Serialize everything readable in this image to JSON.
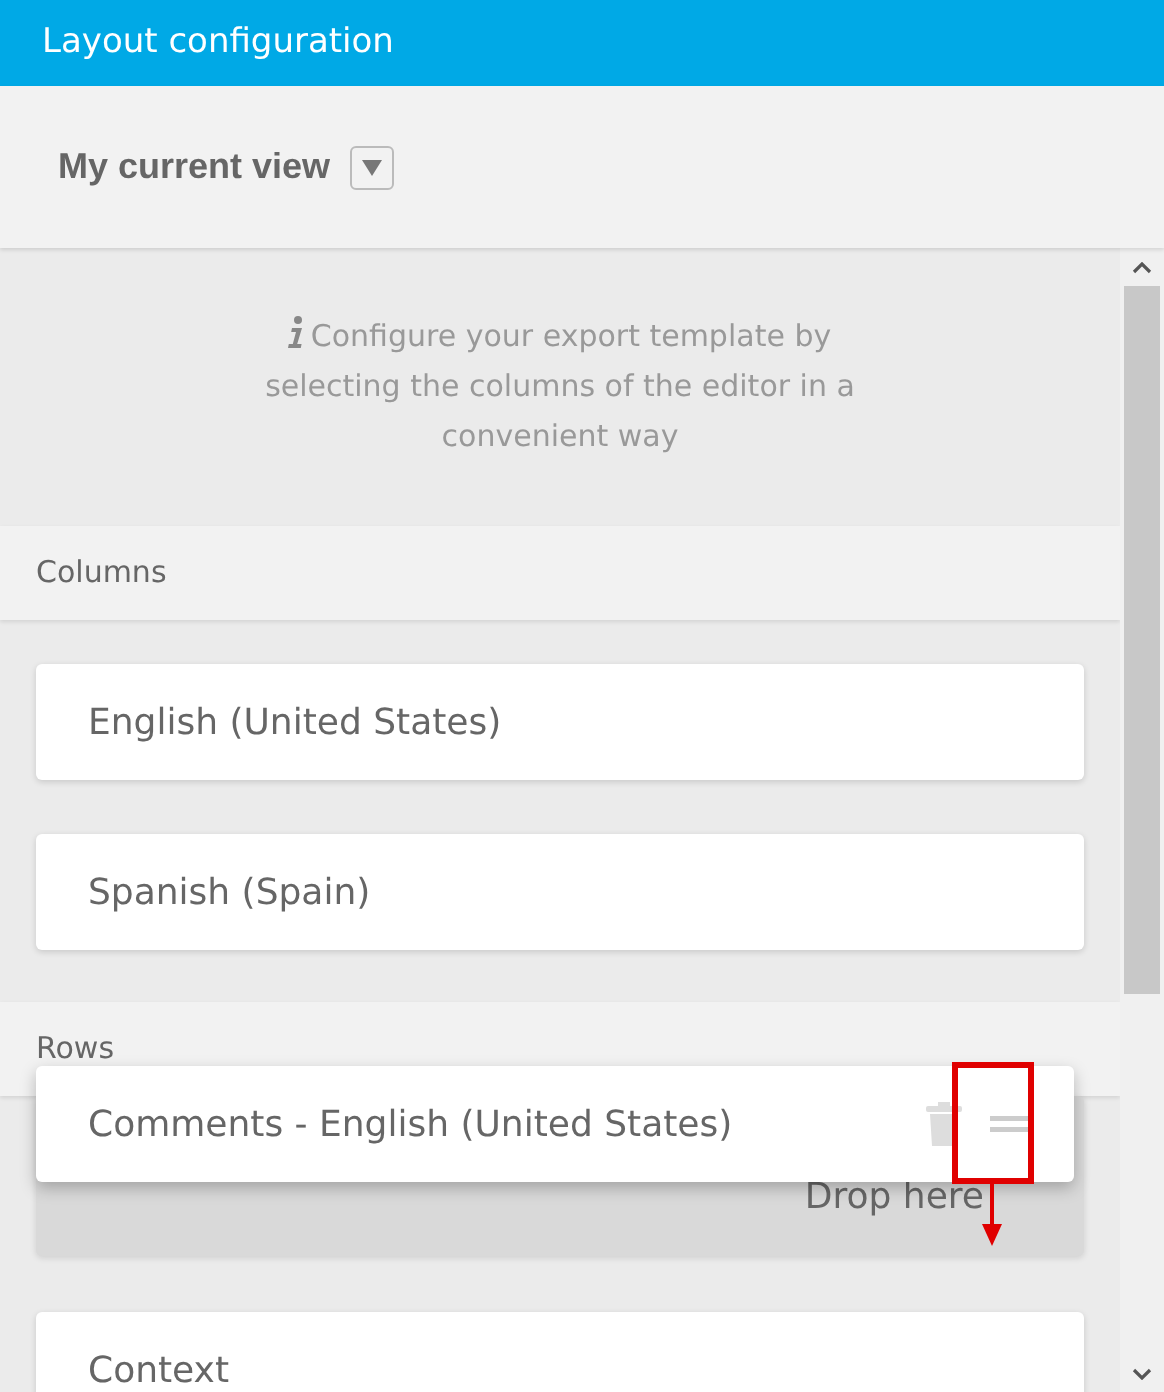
{
  "header": {
    "title": "Layout configuration"
  },
  "view_selector": {
    "label": "My current view"
  },
  "info": {
    "text": "Configure your export template by selecting the columns of the editor in a convenient way"
  },
  "sections": [
    {
      "title": "Columns",
      "items": [
        {
          "label": "English (United States)"
        },
        {
          "label": "Spanish (Spain)"
        }
      ]
    },
    {
      "title": "Rows",
      "drop_zone": {
        "label": "Drop here"
      },
      "items": [
        {
          "label": "Context"
        }
      ]
    }
  ],
  "dragged_item": {
    "label": "Comments - English (United States)"
  }
}
